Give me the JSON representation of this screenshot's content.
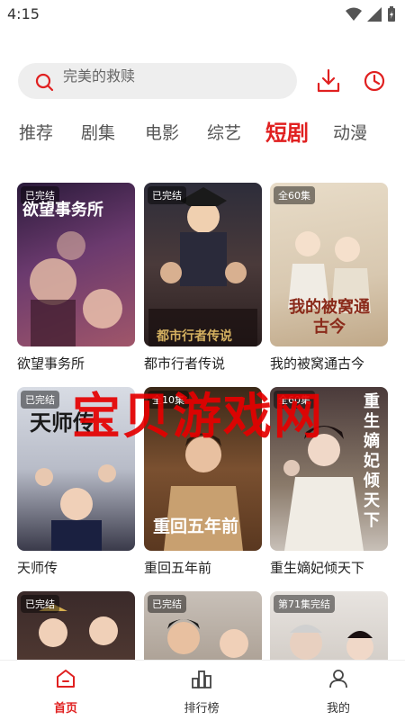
{
  "status": {
    "time": "4:15"
  },
  "search": {
    "text": "完美的救赎"
  },
  "tabs": [
    {
      "label": "推荐"
    },
    {
      "label": "剧集"
    },
    {
      "label": "电影"
    },
    {
      "label": "综艺"
    },
    {
      "label": "短剧",
      "active": true
    },
    {
      "label": "动漫"
    }
  ],
  "cards": [
    {
      "badge": "已完结",
      "title": "欲望事务所",
      "poster_text": "欲望事务所"
    },
    {
      "badge": "已完结",
      "title": "都市行者传说",
      "poster_text": "都市行者传说"
    },
    {
      "badge": "全60集",
      "title": "我的被窝通古今",
      "poster_text": "我的被窝通古今"
    },
    {
      "badge": "已完结",
      "title": "天师传",
      "poster_text": "天师传"
    },
    {
      "badge": "全10集",
      "title": "重回五年前",
      "poster_text": "重回五年前"
    },
    {
      "badge": "全60集",
      "title": "重生嫡妃倾天下",
      "poster_text": "重生嫡妃倾天下"
    },
    {
      "badge": "已完结",
      "title": ""
    },
    {
      "badge": "已完结",
      "title": ""
    },
    {
      "badge": "第71集完结",
      "title": ""
    }
  ],
  "watermark": "宝贝游戏网",
  "bottom_nav": [
    {
      "label": "首页",
      "active": true,
      "icon": "home-icon"
    },
    {
      "label": "排行榜",
      "icon": "ranking-icon"
    },
    {
      "label": "我的",
      "icon": "profile-icon"
    }
  ],
  "colors": {
    "accent": "#e02020"
  }
}
